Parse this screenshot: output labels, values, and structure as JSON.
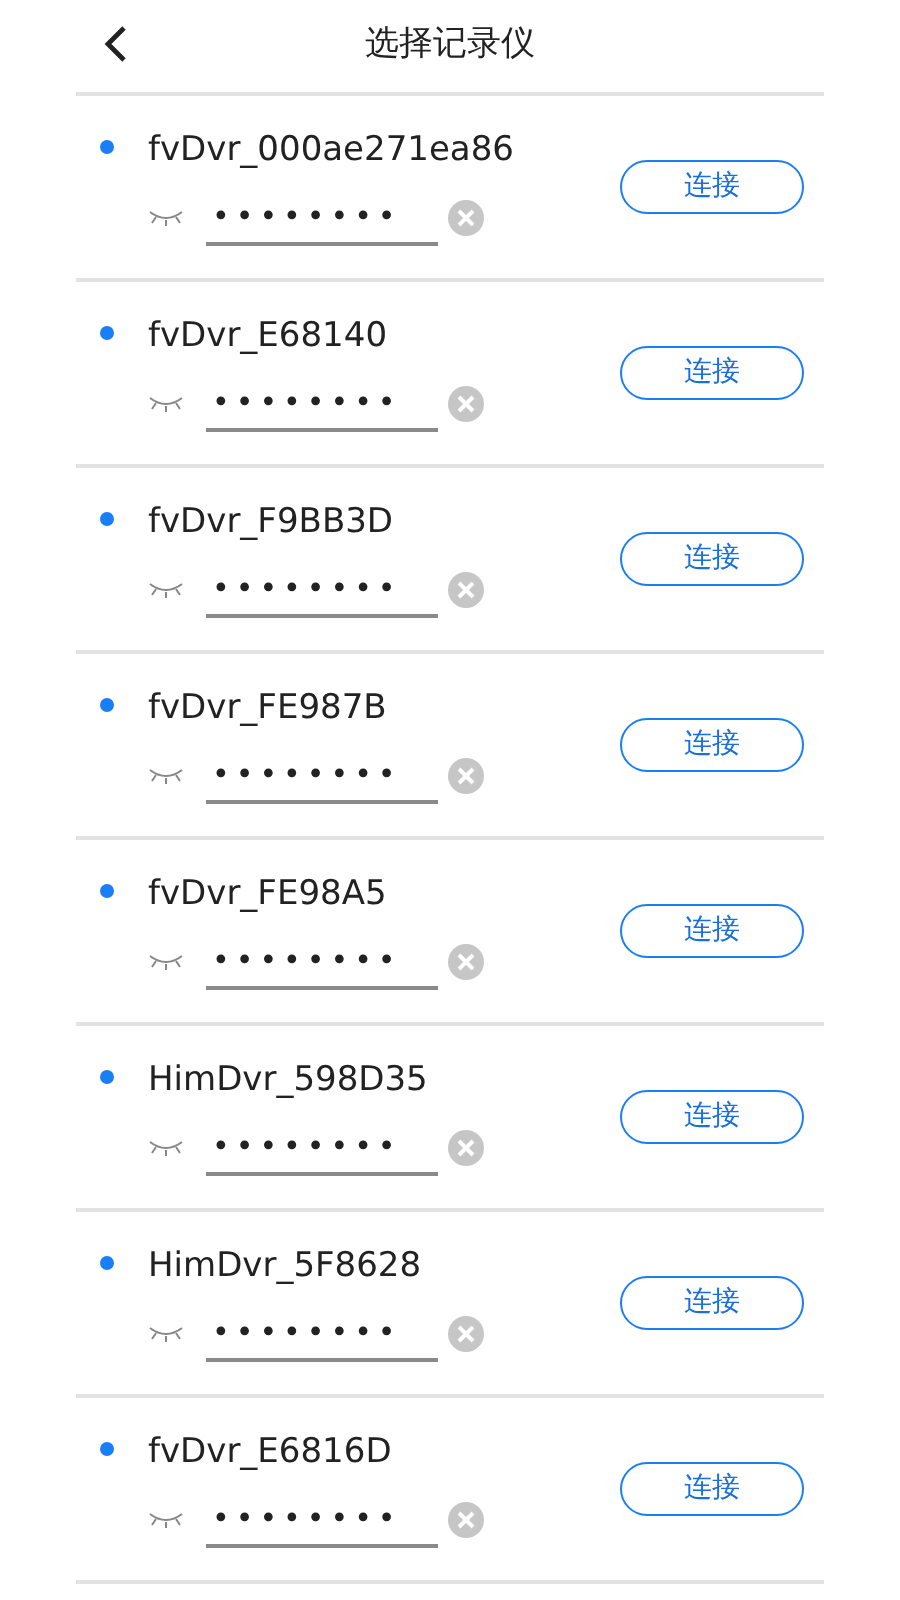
{
  "header": {
    "title": "选择记录仪"
  },
  "devices": [
    {
      "name": "fvDvr_000ae271ea86",
      "password": "••••••••",
      "button": "连接"
    },
    {
      "name": "fvDvr_E68140",
      "password": "••••••••",
      "button": "连接"
    },
    {
      "name": "fvDvr_F9BB3D",
      "password": "••••••••",
      "button": "连接"
    },
    {
      "name": "fvDvr_FE987B",
      "password": "••••••••",
      "button": "连接"
    },
    {
      "name": "fvDvr_FE98A5",
      "password": "••••••••",
      "button": "连接"
    },
    {
      "name": "HimDvr_598D35",
      "password": "••••••••",
      "button": "连接"
    },
    {
      "name": "HimDvr_5F8628",
      "password": "••••••••",
      "button": "连接"
    },
    {
      "name": "fvDvr_E6816D",
      "password": "••••••••",
      "button": "连接"
    }
  ]
}
